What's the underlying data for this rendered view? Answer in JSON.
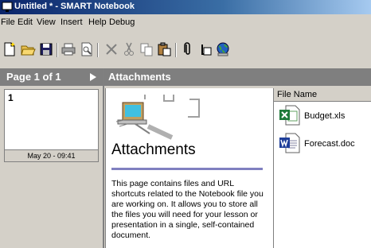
{
  "window": {
    "title": "Untitled * - SMART Notebook"
  },
  "menu": [
    "File",
    "Edit",
    "View",
    "Insert",
    "Help",
    "Debug"
  ],
  "toolbar": {
    "icons": [
      "new-page-icon",
      "open-folder-icon",
      "save-icon",
      "print-icon",
      "print-preview-icon",
      "delete-icon",
      "cut-icon",
      "copy-icon",
      "paste-icon",
      "attachment-icon",
      "clone-icon",
      "globe-icon"
    ]
  },
  "sidebar": {
    "page_indicator": "Page 1 of 1",
    "thumbnails": [
      {
        "number": "1",
        "date": "May 20 - 09:41"
      }
    ]
  },
  "main": {
    "header": "Attachments",
    "page": {
      "title": "Attachments",
      "body": "This page contains files and URL shortcuts related to the Notebook file you are working on.  It allows you to store all the files you will need for your lesson or presentation in a single, self-contained document."
    },
    "file_list": {
      "column": "File Name",
      "files": [
        {
          "name": "Budget.xls",
          "icon": "excel-file-icon"
        },
        {
          "name": "Forecast.doc",
          "icon": "word-file-icon"
        }
      ]
    }
  },
  "colors": {
    "title_gradient_start": "#0a246a",
    "panel_header": "#7f7f7f",
    "face": "#d4d0c8",
    "rule": "#8080c0"
  }
}
